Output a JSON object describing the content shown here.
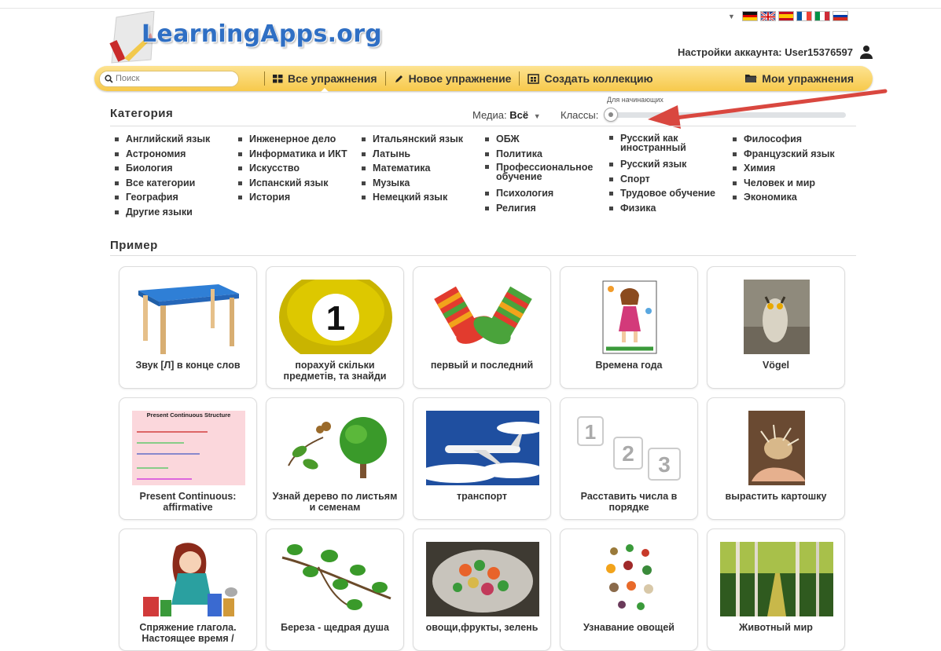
{
  "header": {
    "logo_text": "LearningApps.org",
    "account_label": "Настройки аккаунта: User15376597",
    "flags": [
      "german-flag",
      "uk-flag",
      "spanish-flag",
      "french-flag",
      "italian-flag",
      "russian-flag"
    ]
  },
  "nav": {
    "search_placeholder": "Поиск",
    "all_exercises": "Все упражнения",
    "new_exercise": "Новое упражнение",
    "create_collection": "Создать коллекцию",
    "my_exercises": "Мои упражнения"
  },
  "filters": {
    "category_title": "Категория",
    "media_label": "Медиа:",
    "media_value": "Всё",
    "classes_label": "Классы:",
    "beginner_label": "Для начинающих"
  },
  "categories": [
    [
      "Английский язык",
      "Астрономия",
      "Биология",
      "Все категории",
      "География",
      "Другие языки"
    ],
    [
      "Инженерное дело",
      "Информатика и ИКТ",
      "Искусство",
      "Испанский язык",
      "История"
    ],
    [
      "Итальянский язык",
      "Латынь",
      "Математика",
      "Музыка",
      "Немецкий язык"
    ],
    [
      "ОБЖ",
      "Политика",
      "Профессиональное обучение",
      "Психология",
      "Религия"
    ],
    [
      "Русский как иностранный",
      "Русский язык",
      "Спорт",
      "Трудовое обучение",
      "Физика"
    ],
    [
      "Философия",
      "Французский язык",
      "Химия",
      "Человек и мир",
      "Экономика"
    ]
  ],
  "examples_title": "Пример",
  "cards": [
    {
      "label": "Звук [Л] в конце слов",
      "icon": "table"
    },
    {
      "label": "порахуй скільки предметів, та знайди",
      "icon": "ball-number-1"
    },
    {
      "label": "первый и последний",
      "icon": "socks"
    },
    {
      "label": "Времена года",
      "icon": "girl-drawing"
    },
    {
      "label": "Vögel",
      "icon": "owl"
    },
    {
      "label": "Present Continuous: affirmative",
      "icon": "grammar-slide",
      "thumb_title": "Present Continuous Structure"
    },
    {
      "label": "Узнай дерево по листьям и семенам",
      "icon": "tree"
    },
    {
      "label": "транспорт",
      "icon": "airplane"
    },
    {
      "label": "Расставить числа в порядке",
      "icon": "number-cards"
    },
    {
      "label": "вырастить картошку",
      "icon": "potato-hand"
    },
    {
      "label": "Спряжение глагола. Настоящее время /",
      "icon": "girl-books"
    },
    {
      "label": "Береза - щедрая душа",
      "icon": "birch-branch"
    },
    {
      "label": "овощи,фрукты, зелень",
      "icon": "salad"
    },
    {
      "label": "Узнавание овощей",
      "icon": "vegetables"
    },
    {
      "label": "Животный мир",
      "icon": "forest"
    }
  ],
  "colors": {
    "navbar": "#f7c94b",
    "logo": "#2f6fc4",
    "arrow": "#d9473f"
  }
}
